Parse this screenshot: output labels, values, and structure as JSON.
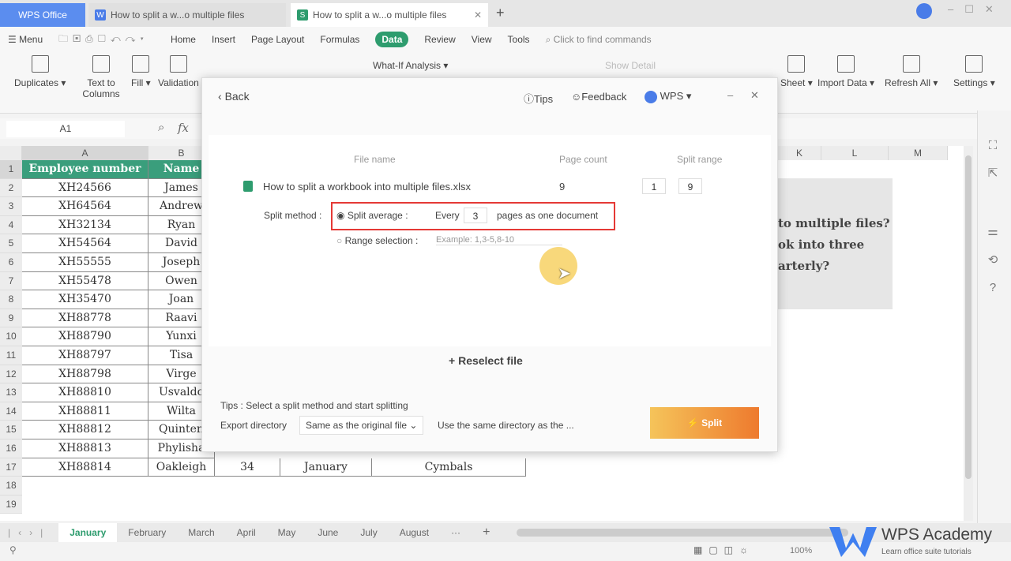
{
  "window": {
    "tabs": [
      {
        "label": "WPS Office"
      },
      {
        "label": "How to split a w...o multiple files"
      },
      {
        "label": "How to split a w...o multiple files"
      }
    ],
    "new_tab": "+"
  },
  "menu": {
    "menu_label": "Menu",
    "items": [
      "Home",
      "Insert",
      "Page Layout",
      "Formulas",
      "Data",
      "Review",
      "View",
      "Tools"
    ],
    "active": "Data",
    "search": "Click to find commands"
  },
  "ribbon": {
    "items": [
      "Duplicates",
      "Text to Columns",
      "Fill",
      "Validation",
      "What-If Analysis",
      "Show Detail",
      "Sheet",
      "Import Data",
      "Refresh All",
      "Settings"
    ]
  },
  "formula": {
    "cell_ref": "A1",
    "fx": "fx"
  },
  "columns": [
    "A",
    "B",
    "K",
    "L",
    "M"
  ],
  "rows": [
    [
      "Employee number",
      "Name"
    ],
    [
      "XH24566",
      "James"
    ],
    [
      "XH64564",
      "Andrew"
    ],
    [
      "XH32134",
      "Ryan"
    ],
    [
      "XH54564",
      "David"
    ],
    [
      "XH55555",
      "Joseph"
    ],
    [
      "XH55478",
      "Owen"
    ],
    [
      "XH35470",
      "Joan"
    ],
    [
      "XH88778",
      "Raavi"
    ],
    [
      "XH88790",
      "Yunxi"
    ],
    [
      "XH88797",
      "Tisa"
    ],
    [
      "XH88798",
      "Virge"
    ],
    [
      "XH88810",
      "Usvaldo"
    ],
    [
      "XH88811",
      "Wilta"
    ],
    [
      "XH88812",
      "Quinten"
    ],
    [
      "XH88813",
      "Phylisha"
    ],
    [
      "XH88814",
      "Oakleigh",
      "34",
      "January",
      "Cymbals"
    ]
  ],
  "row_numbers": [
    "1",
    "2",
    "3",
    "4",
    "5",
    "6",
    "7",
    "8",
    "9",
    "10",
    "11",
    "12",
    "13",
    "14",
    "15",
    "16",
    "17",
    "18",
    "19"
  ],
  "textbox": {
    "lines": [
      "to multiple files?",
      "ok into three",
      "arterly?"
    ]
  },
  "dialog": {
    "back": "Back",
    "tips": "Tips",
    "feedback": "Feedback",
    "wps": "WPS",
    "col_file": "File name",
    "col_pages": "Page count",
    "col_range": "Split range",
    "file_name": "How to split a workbook into multiple files.xlsx",
    "page_count": "9",
    "range_from": "1",
    "range_to": "9",
    "split_method": "Split method :",
    "opt_average": "Split average :",
    "every": "Every",
    "every_value": "3",
    "pages_doc": "pages as one document",
    "opt_range": "Range selection :",
    "range_placeholder": "Example: 1,3-5,8-10",
    "reselect": "Reselect file",
    "tips_text": "Tips : Select a split method and start splitting",
    "export_label": "Export directory",
    "export_value": "Same as the original file",
    "export_desc": "Use the same directory as the ...",
    "split": "Split"
  },
  "sheets": {
    "tabs": [
      "January",
      "February",
      "March",
      "April",
      "May",
      "June",
      "July",
      "August"
    ],
    "active": "January",
    "more": "···"
  },
  "status": {
    "zoom": "100%"
  },
  "watermark": {
    "title": "WPS Academy",
    "subtitle": "Learn office suite tutorials"
  },
  "colors": {
    "accent": "#2e9c6e",
    "highlight": "#e53935"
  }
}
